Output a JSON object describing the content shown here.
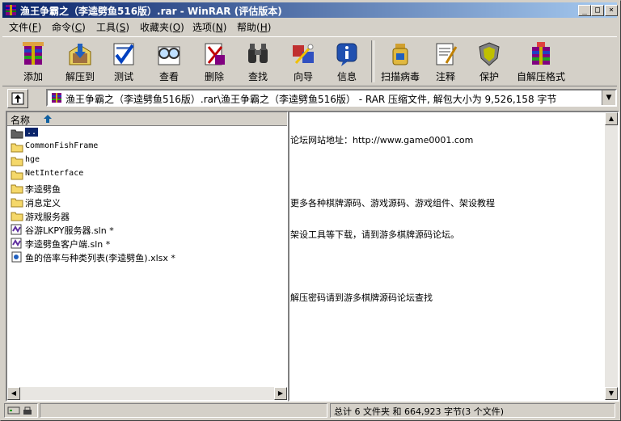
{
  "window": {
    "title": "渔王争霸之（李逵劈鱼516版）.rar - WinRAR (评估版本)",
    "controls": [
      "_",
      "□",
      "×"
    ]
  },
  "menu": [
    {
      "label": "文件",
      "key": "F"
    },
    {
      "label": "命令",
      "key": "C"
    },
    {
      "label": "工具",
      "key": "S"
    },
    {
      "label": "收藏夹",
      "key": "O"
    },
    {
      "label": "选项",
      "key": "N"
    },
    {
      "label": "帮助",
      "key": "H"
    }
  ],
  "toolbar": [
    {
      "label": "添加",
      "icon": "add-archive-icon"
    },
    {
      "label": "解压到",
      "icon": "extract-icon"
    },
    {
      "label": "测试",
      "icon": "test-icon"
    },
    {
      "label": "查看",
      "icon": "view-icon"
    },
    {
      "label": "删除",
      "icon": "delete-icon"
    },
    {
      "label": "查找",
      "icon": "find-icon"
    },
    {
      "label": "向导",
      "icon": "wizard-icon"
    },
    {
      "label": "信息",
      "icon": "info-icon"
    },
    {
      "label": "扫描病毒",
      "icon": "virus-scan-icon"
    },
    {
      "label": "注释",
      "icon": "comment-icon"
    },
    {
      "label": "保护",
      "icon": "protect-icon"
    },
    {
      "label": "自解压格式",
      "icon": "sfx-icon"
    }
  ],
  "address": {
    "path": "渔王争霸之（李逵劈鱼516版）.rar\\渔王争霸之（李逵劈鱼516版） - RAR 压缩文件, 解包大小为 9,526,158 字节"
  },
  "file_list": {
    "column_name": "名称",
    "items": [
      {
        "name": "..",
        "type": "parent",
        "selected": true
      },
      {
        "name": "CommonFishFrame",
        "type": "folder"
      },
      {
        "name": "hge",
        "type": "folder"
      },
      {
        "name": "NetInterface",
        "type": "folder"
      },
      {
        "name": "李逵劈鱼",
        "type": "folder"
      },
      {
        "name": "消息定义",
        "type": "folder"
      },
      {
        "name": "游戏服务器",
        "type": "folder"
      },
      {
        "name": "谷游LKPY服务器.sln *",
        "type": "sln"
      },
      {
        "name": "李逵劈鱼客户端.sln *",
        "type": "sln"
      },
      {
        "name": "鱼的倍率与种类列表(李逵劈鱼).xlsx *",
        "type": "xlsx"
      }
    ]
  },
  "comment": {
    "lines": [
      "论坛网站地址：http://www.game0001.com",
      "",
      "更多各种棋牌源码、游戏源码、游戏组件、架设教程",
      "架设工具等下载，请到游多棋牌源码论坛。",
      "",
      "解压密码请到游多棋牌源码论坛查找"
    ]
  },
  "status": {
    "summary": "总计 6 文件夹 和 664,923 字节(3 个文件)"
  }
}
